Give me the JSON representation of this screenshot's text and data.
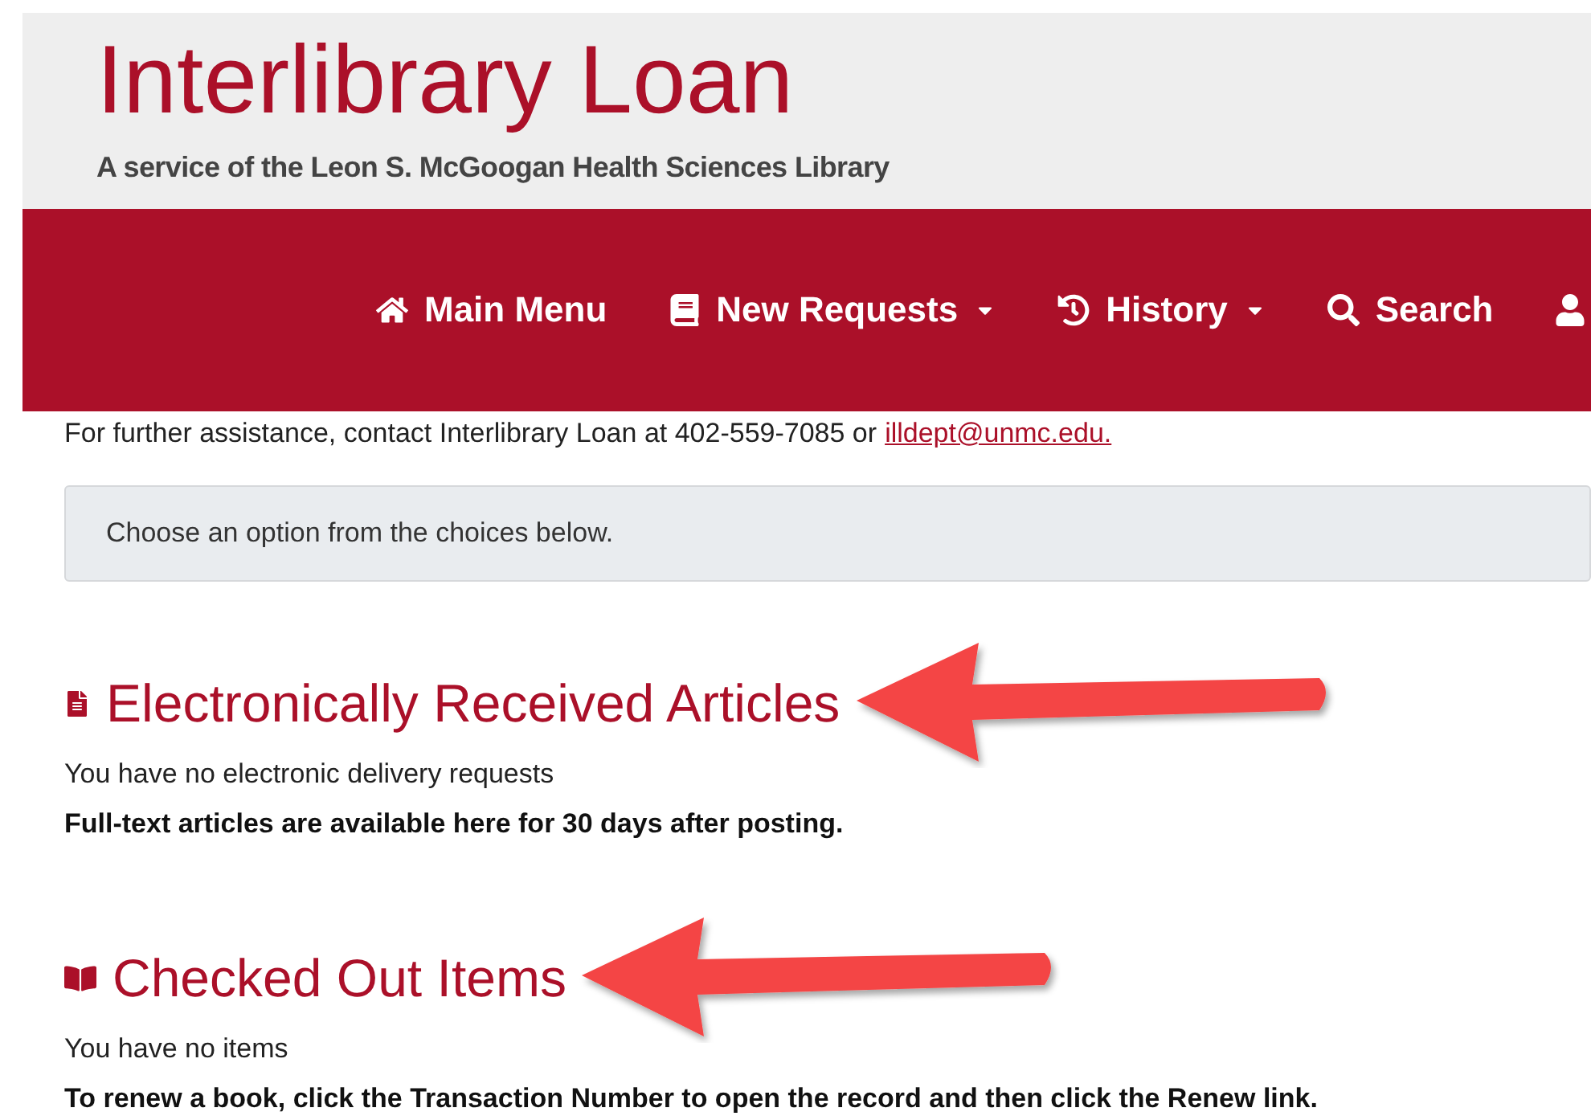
{
  "header": {
    "title": "Interlibrary Loan",
    "subtitle": "A service of the Leon S. McGoogan Health Sciences Library"
  },
  "nav": [
    {
      "label": "Main Menu",
      "dropdown": false
    },
    {
      "label": "New Requests",
      "dropdown": true
    },
    {
      "label": "History",
      "dropdown": true
    },
    {
      "label": "Search",
      "dropdown": false
    }
  ],
  "contact": {
    "text": "For further assistance, contact Interlibrary Loan at 402-559-7085 or",
    "email": "illdept@unmc.edu."
  },
  "notice": "Choose an option from the choices below.",
  "sections": [
    {
      "title": "Electronically Received Articles",
      "status": "You have no electronic delivery requests",
      "note": "Full-text articles are available here for 30 days after posting.",
      "arrow": true
    },
    {
      "title": "Checked Out Items",
      "status": "You have no items",
      "note": "To renew a book, click the Transaction Number to open the record and then click the Renew link.",
      "arrow": true
    }
  ]
}
